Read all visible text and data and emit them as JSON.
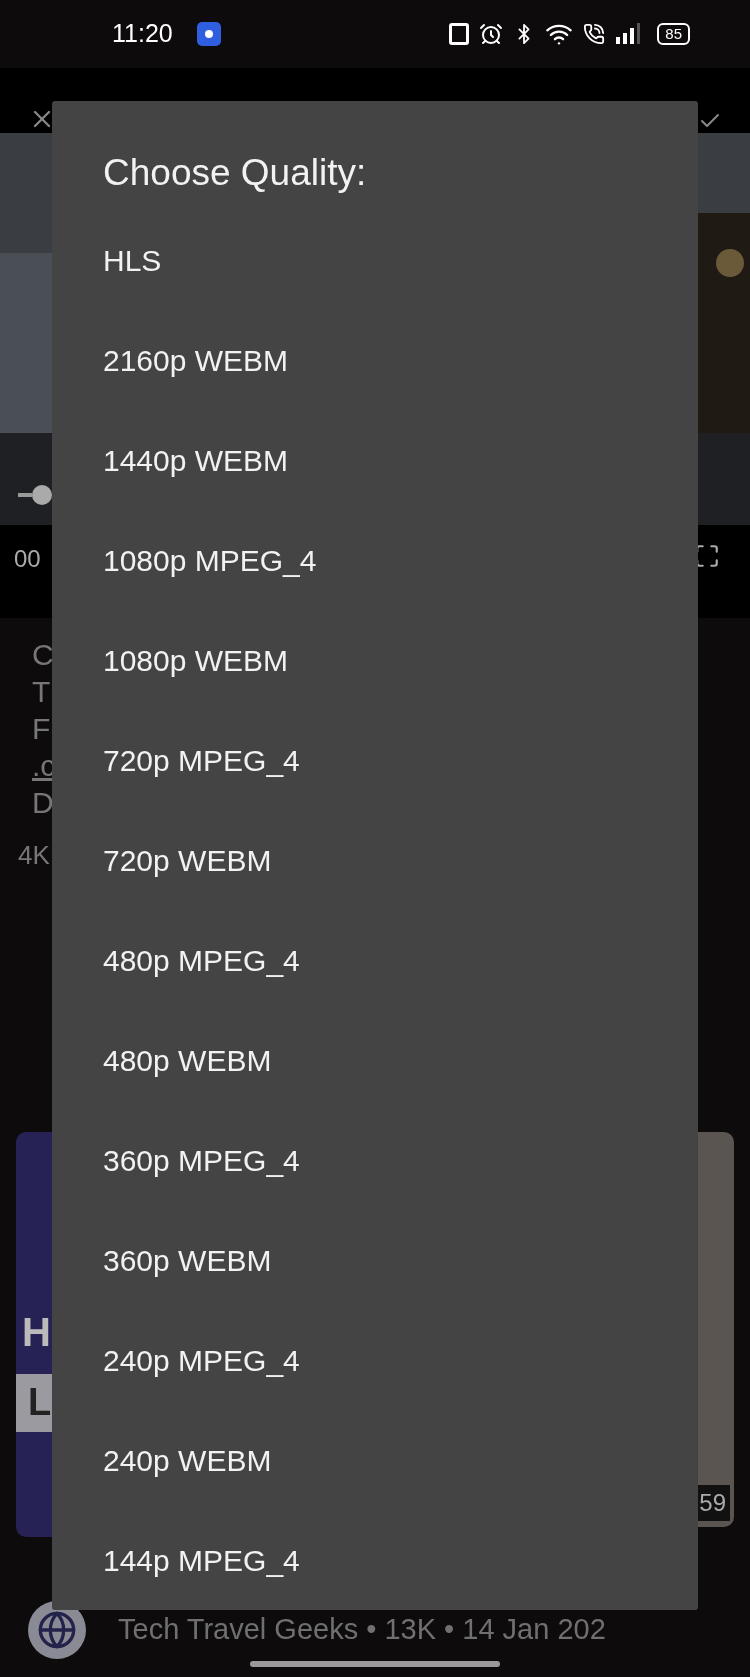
{
  "status_bar": {
    "time": "11:20",
    "battery": "85"
  },
  "video": {
    "time_fragment": "00"
  },
  "description_fragments": [
    {
      "text": "C",
      "kind": "text"
    },
    {
      "text": "T",
      "kind": "text"
    },
    {
      "text": "F",
      "kind": "text"
    },
    {
      "text": ".c",
      "kind": "link"
    },
    {
      "text": "D",
      "kind": "text"
    }
  ],
  "meta_fragment": "4K",
  "left_card": {
    "title_fragment": "H",
    "label_fragment": "L"
  },
  "right_card": {
    "duration_fragment": "59"
  },
  "channel_line": "Tech Travel Geeks • 13K • 14 Jan 202",
  "dialog": {
    "title": "Choose Quality:",
    "options": [
      "HLS",
      "2160p WEBM",
      "1440p WEBM",
      "1080p MPEG_4",
      "1080p WEBM",
      "720p MPEG_4",
      "720p WEBM",
      "480p MPEG_4",
      "480p WEBM",
      "360p MPEG_4",
      "360p WEBM",
      "240p MPEG_4",
      "240p WEBM",
      "144p MPEG_4"
    ]
  }
}
